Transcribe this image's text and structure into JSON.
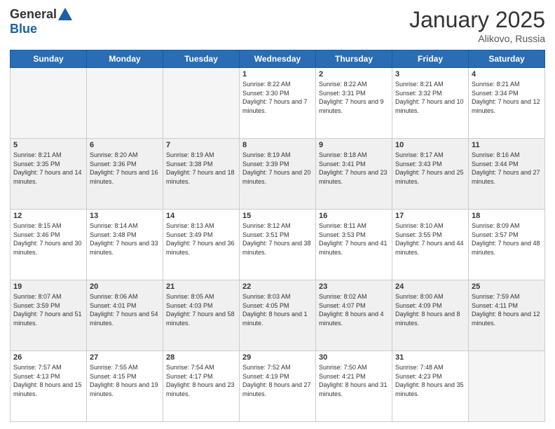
{
  "logo": {
    "general": "General",
    "blue": "Blue"
  },
  "header": {
    "month_year": "January 2025",
    "location": "Alikovo, Russia"
  },
  "weekdays": [
    "Sunday",
    "Monday",
    "Tuesday",
    "Wednesday",
    "Thursday",
    "Friday",
    "Saturday"
  ],
  "weeks": [
    [
      {
        "day": "",
        "empty": true
      },
      {
        "day": "",
        "empty": true
      },
      {
        "day": "",
        "empty": true
      },
      {
        "day": "1",
        "sunrise": "8:22 AM",
        "sunset": "3:30 PM",
        "daylight": "7 hours and 7 minutes."
      },
      {
        "day": "2",
        "sunrise": "8:22 AM",
        "sunset": "3:31 PM",
        "daylight": "7 hours and 9 minutes."
      },
      {
        "day": "3",
        "sunrise": "8:21 AM",
        "sunset": "3:32 PM",
        "daylight": "7 hours and 10 minutes."
      },
      {
        "day": "4",
        "sunrise": "8:21 AM",
        "sunset": "3:34 PM",
        "daylight": "7 hours and 12 minutes."
      }
    ],
    [
      {
        "day": "5",
        "sunrise": "8:21 AM",
        "sunset": "3:35 PM",
        "daylight": "7 hours and 14 minutes."
      },
      {
        "day": "6",
        "sunrise": "8:20 AM",
        "sunset": "3:36 PM",
        "daylight": "7 hours and 16 minutes."
      },
      {
        "day": "7",
        "sunrise": "8:19 AM",
        "sunset": "3:38 PM",
        "daylight": "7 hours and 18 minutes."
      },
      {
        "day": "8",
        "sunrise": "8:19 AM",
        "sunset": "3:39 PM",
        "daylight": "7 hours and 20 minutes."
      },
      {
        "day": "9",
        "sunrise": "8:18 AM",
        "sunset": "3:41 PM",
        "daylight": "7 hours and 23 minutes."
      },
      {
        "day": "10",
        "sunrise": "8:17 AM",
        "sunset": "3:43 PM",
        "daylight": "7 hours and 25 minutes."
      },
      {
        "day": "11",
        "sunrise": "8:16 AM",
        "sunset": "3:44 PM",
        "daylight": "7 hours and 27 minutes."
      }
    ],
    [
      {
        "day": "12",
        "sunrise": "8:15 AM",
        "sunset": "3:46 PM",
        "daylight": "7 hours and 30 minutes."
      },
      {
        "day": "13",
        "sunrise": "8:14 AM",
        "sunset": "3:48 PM",
        "daylight": "7 hours and 33 minutes."
      },
      {
        "day": "14",
        "sunrise": "8:13 AM",
        "sunset": "3:49 PM",
        "daylight": "7 hours and 36 minutes."
      },
      {
        "day": "15",
        "sunrise": "8:12 AM",
        "sunset": "3:51 PM",
        "daylight": "7 hours and 38 minutes."
      },
      {
        "day": "16",
        "sunrise": "8:11 AM",
        "sunset": "3:53 PM",
        "daylight": "7 hours and 41 minutes."
      },
      {
        "day": "17",
        "sunrise": "8:10 AM",
        "sunset": "3:55 PM",
        "daylight": "7 hours and 44 minutes."
      },
      {
        "day": "18",
        "sunrise": "8:09 AM",
        "sunset": "3:57 PM",
        "daylight": "7 hours and 48 minutes."
      }
    ],
    [
      {
        "day": "19",
        "sunrise": "8:07 AM",
        "sunset": "3:59 PM",
        "daylight": "7 hours and 51 minutes."
      },
      {
        "day": "20",
        "sunrise": "8:06 AM",
        "sunset": "4:01 PM",
        "daylight": "7 hours and 54 minutes."
      },
      {
        "day": "21",
        "sunrise": "8:05 AM",
        "sunset": "4:03 PM",
        "daylight": "7 hours and 58 minutes."
      },
      {
        "day": "22",
        "sunrise": "8:03 AM",
        "sunset": "4:05 PM",
        "daylight": "8 hours and 1 minute."
      },
      {
        "day": "23",
        "sunrise": "8:02 AM",
        "sunset": "4:07 PM",
        "daylight": "8 hours and 4 minutes."
      },
      {
        "day": "24",
        "sunrise": "8:00 AM",
        "sunset": "4:09 PM",
        "daylight": "8 hours and 8 minutes."
      },
      {
        "day": "25",
        "sunrise": "7:59 AM",
        "sunset": "4:11 PM",
        "daylight": "8 hours and 12 minutes."
      }
    ],
    [
      {
        "day": "26",
        "sunrise": "7:57 AM",
        "sunset": "4:13 PM",
        "daylight": "8 hours and 15 minutes."
      },
      {
        "day": "27",
        "sunrise": "7:55 AM",
        "sunset": "4:15 PM",
        "daylight": "8 hours and 19 minutes."
      },
      {
        "day": "28",
        "sunrise": "7:54 AM",
        "sunset": "4:17 PM",
        "daylight": "8 hours and 23 minutes."
      },
      {
        "day": "29",
        "sunrise": "7:52 AM",
        "sunset": "4:19 PM",
        "daylight": "8 hours and 27 minutes."
      },
      {
        "day": "30",
        "sunrise": "7:50 AM",
        "sunset": "4:21 PM",
        "daylight": "8 hours and 31 minutes."
      },
      {
        "day": "31",
        "sunrise": "7:48 AM",
        "sunset": "4:23 PM",
        "daylight": "8 hours and 35 minutes."
      },
      {
        "day": "",
        "empty": true
      }
    ]
  ],
  "labels": {
    "sunrise": "Sunrise:",
    "sunset": "Sunset:",
    "daylight": "Daylight:"
  }
}
